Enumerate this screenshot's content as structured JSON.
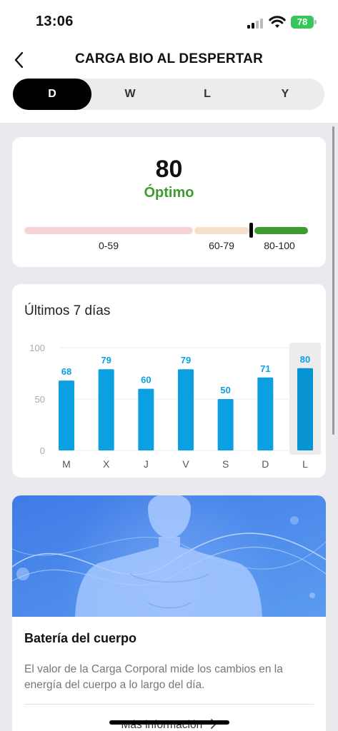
{
  "status_bar": {
    "time": "13:06",
    "battery": "78"
  },
  "header": {
    "title": "CARGA BIO AL DESPERTAR"
  },
  "tabs": [
    {
      "label": "D",
      "active": true
    },
    {
      "label": "W",
      "active": false
    },
    {
      "label": "L",
      "active": false
    },
    {
      "label": "Y",
      "active": false
    }
  ],
  "summary": {
    "score": "80",
    "status": "Óptimo",
    "status_color": "#3e9b2f",
    "marker_value": 80,
    "ranges": [
      {
        "label": "0-59",
        "color": "#f4d4d4"
      },
      {
        "label": "60-79",
        "color": "#f6e0cc"
      },
      {
        "label": "80-100",
        "color": "#3e9b2f"
      }
    ]
  },
  "chart": {
    "title": "Últimos 7 días",
    "highlight_index": 6
  },
  "chart_data": {
    "type": "bar",
    "categories": [
      "M",
      "X",
      "J",
      "V",
      "S",
      "D",
      "L"
    ],
    "values": [
      68,
      79,
      60,
      79,
      50,
      71,
      80
    ],
    "title": "Últimos 7 días",
    "xlabel": "",
    "ylabel": "",
    "ylim": [
      0,
      100
    ],
    "yticks": [
      0,
      50,
      100
    ],
    "grid": true,
    "bar_color": "#0aa0e1"
  },
  "info_card": {
    "title": "Batería del cuerpo",
    "description": "El valor de la Carga Corporal mide los cambios en la energía del cuerpo a lo largo del día.",
    "more_label": "Más información",
    "more_icon": "chevron-right-icon"
  }
}
